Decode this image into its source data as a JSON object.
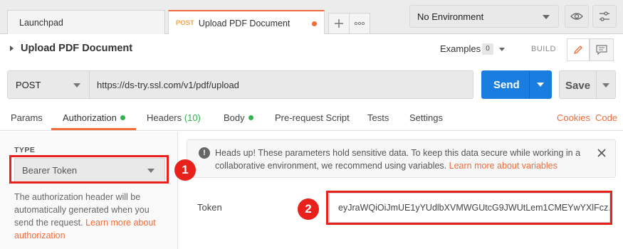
{
  "tabs": [
    {
      "label": "Launchpad"
    },
    {
      "method": "POST",
      "label": "Upload PDF Document",
      "unsaved": true
    }
  ],
  "environment": {
    "selected": "No Environment"
  },
  "request": {
    "title": "Upload PDF Document",
    "examples_label": "Examples",
    "examples_count": "0",
    "mode_label": "BUILD",
    "method": "POST",
    "url": "https://ds-try.ssl.com/v1/pdf/upload",
    "send_label": "Send",
    "save_label": "Save"
  },
  "subtabs": {
    "params": "Params",
    "authorization": "Authorization",
    "headers": "Headers",
    "headers_count": "(10)",
    "body": "Body",
    "prerequest": "Pre-request Script",
    "tests": "Tests",
    "settings": "Settings",
    "cookies": "Cookies",
    "code": "Code"
  },
  "auth": {
    "type_label": "TYPE",
    "type_value": "Bearer Token",
    "help_text": "The authorization header will be automatically generated when you send the request. ",
    "help_link": "Learn more about authorization",
    "notice_text": "Heads up! These parameters hold sensitive data. To keep this data secure while working in a collaborative environment, we recommend using variables. ",
    "notice_link": "Learn more about variables",
    "token_label": "Token",
    "token_value": "eyJraWQiOiJmUE1yYUdlbXVMWGUtcG9JWUtLem1CMEYwYXlFcz..."
  },
  "annotations": {
    "badge1": "1",
    "badge2": "2"
  },
  "colors": {
    "accent": "#f26b3a",
    "send": "#1a7ee1",
    "highlight": "#e8211c",
    "active": "#2fb34a"
  }
}
